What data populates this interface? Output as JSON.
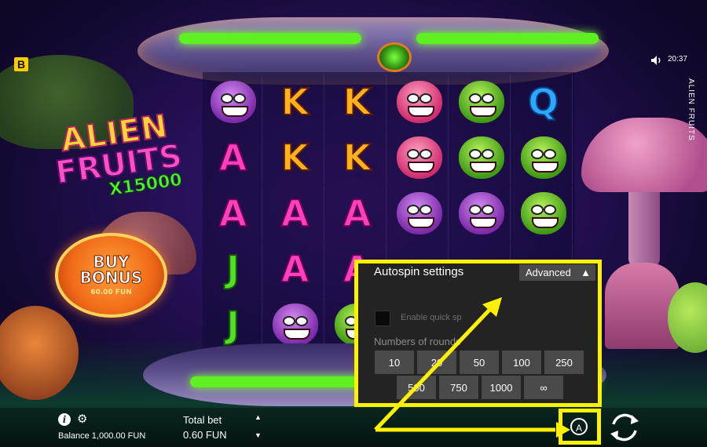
{
  "game": {
    "badge": "B",
    "logo": {
      "line1": "ALIEN",
      "line2": "FRUITS",
      "line3": "X15000"
    },
    "vertical_title": "ALIEN FRUITS",
    "clock": "20:37",
    "buy_bonus": {
      "line1": "BUY",
      "line2": "BONUS",
      "price": "60.00 FUN"
    }
  },
  "reels": {
    "rows": [
      [
        "purple",
        "K",
        "K",
        "pink",
        "green",
        "Q"
      ],
      [
        "A",
        "K",
        "K",
        "pink",
        "green",
        "green"
      ],
      [
        "A",
        "A",
        "A",
        "purple",
        "purple",
        "green"
      ],
      [
        "J",
        "A",
        "A",
        "",
        "",
        ""
      ],
      [
        "J",
        "purple",
        "green",
        "",
        "",
        ""
      ]
    ]
  },
  "bottom": {
    "balance": "Balance 1,000.00 FUN",
    "total_bet_label": "Total bet",
    "total_bet_value": "0.60 FUN"
  },
  "autospin": {
    "title": "Autospin settings",
    "advanced_label": "Advanced",
    "enable_quick_spin_label": "Enable quick sp",
    "rounds_label": "Numbers of rounds",
    "round_options": [
      "10",
      "20",
      "50",
      "100",
      "250",
      "500",
      "750",
      "1000",
      "∞"
    ],
    "autospin_button_glyph": "A"
  },
  "colors": {
    "highlight": "#fff200",
    "panel_bg": "#232323",
    "button_bg": "#4a4a4a"
  }
}
